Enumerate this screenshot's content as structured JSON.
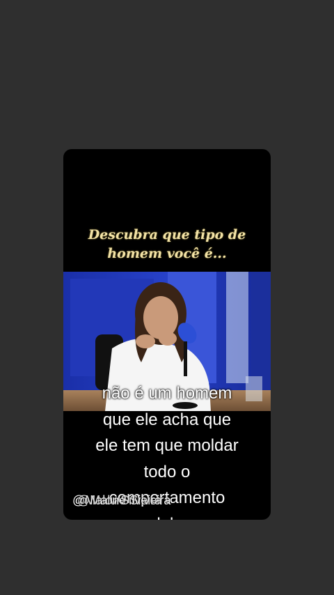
{
  "overlay": {
    "title_lines": [
      "Descubra que tipo de",
      "homem  você é..."
    ]
  },
  "captions": {
    "lines": [
      "não é um homem",
      "que ele acha que",
      "ele tem que moldar",
      "todo o",
      "comportamento",
      "dela"
    ]
  },
  "watermark": {
    "handle": "@Malone Silveira",
    "overlay_handle": "@Malu Silveira"
  },
  "colors": {
    "background": "#2f2f2f",
    "card": "#000000",
    "title": "#f3e3a6"
  },
  "icons": {
    "microphone": "microphone-icon"
  }
}
